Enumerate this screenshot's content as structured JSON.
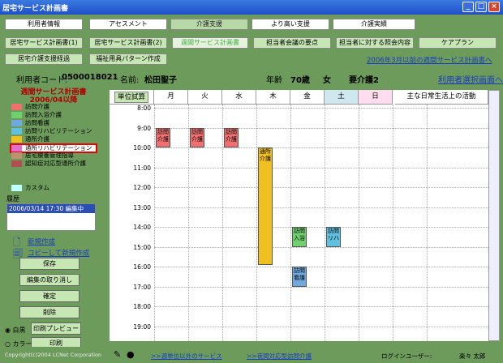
{
  "title": "居宅サービス計画書",
  "nav1": [
    "利用者情報",
    "アセスメント",
    "介護支援",
    "より高い支援",
    "介護実績"
  ],
  "nav2": [
    "居宅サービス計画書(1)",
    "居宅サービス計画書(2)",
    "週間サービス計画書",
    "担当者会議の要点",
    "担当者に対する照会内容",
    "ケアプラン"
  ],
  "nav3": [
    "居宅介護支援経過",
    "福祉用具パターン作成"
  ],
  "link_prev": "2006年3月以前の週間サービス計画書へ",
  "info": {
    "code_label": "利用者コード:",
    "code": "0500018021",
    "name_label": "名前:",
    "name": "松田聖子",
    "age_label": "年齢",
    "age": "70歳",
    "sex": "女",
    "care": "要介護2",
    "select_link": "利用者選択画面へ"
  },
  "left": {
    "title": "週間サービス計画書",
    "date": "2006/04以降",
    "custom": "カスタム",
    "history_label": "履歴",
    "history": "2006/03/14 17:30 編集中"
  },
  "legend": [
    {
      "label": "訪問介護",
      "color": "#f07070"
    },
    {
      "label": "訪問入浴介護",
      "color": "#70d070"
    },
    {
      "label": "訪問看護",
      "color": "#70a8e0"
    },
    {
      "label": "訪問リハビリテーション",
      "color": "#60c0e0"
    },
    {
      "label": "通所介護",
      "color": "#f0c020"
    },
    {
      "label": "通所リハビリテーション",
      "color": "#e070d0"
    },
    {
      "label": "居宅療養管理指導",
      "color": "#c09070"
    },
    {
      "label": "認知症対応型通所介護",
      "color": "#b05050"
    }
  ],
  "custom_color": "#c0ffff",
  "actions": {
    "new": "新規作成",
    "copy": "コピーして新規作成",
    "save": "保存",
    "cancel": "編集の取り消し",
    "confirm": "確定",
    "delete": "削除",
    "preview": "印刷プレビュー",
    "print": "印刷",
    "mono": "白黒",
    "color": "カラー"
  },
  "calc": "単位試算",
  "days": [
    "月",
    "火",
    "水",
    "木",
    "金",
    "土",
    "日"
  ],
  "activity": "主な日常生活上の活動",
  "times": [
    "8:00",
    "9:00",
    "10:00",
    "11:00",
    "12:00",
    "13:00",
    "14:00",
    "15:00",
    "16:00",
    "17:00",
    "18:00",
    "19:00"
  ],
  "events": [
    {
      "day": 0,
      "start": 9,
      "end": 10,
      "text": "訪問介護",
      "color": "#f07070"
    },
    {
      "day": 1,
      "start": 9,
      "end": 10,
      "text": "訪問介護",
      "color": "#f07070"
    },
    {
      "day": 2,
      "start": 9,
      "end": 10,
      "text": "訪問介護",
      "color": "#f07070"
    },
    {
      "day": 3,
      "start": 10,
      "end": 15.9,
      "text": "通所介護",
      "color": "#f0c020"
    },
    {
      "day": 4,
      "start": 14,
      "end": 15,
      "text": "訪問入浴",
      "color": "#70d070"
    },
    {
      "day": 5,
      "start": 14,
      "end": 15,
      "text": "訪問リハ",
      "color": "#60c0e0"
    },
    {
      "day": 4,
      "start": 16,
      "end": 17,
      "text": "訪問看護",
      "color": "#70a8e0"
    }
  ],
  "bottom": {
    "copyright": "Copyright(c)2004 LCNet Corporation",
    "link1": ">>週単位以外のサービス",
    "link2": ">>夜間対応型訪問介護",
    "user_label": "ログインユーザー:",
    "user": "楽々 太郎"
  }
}
